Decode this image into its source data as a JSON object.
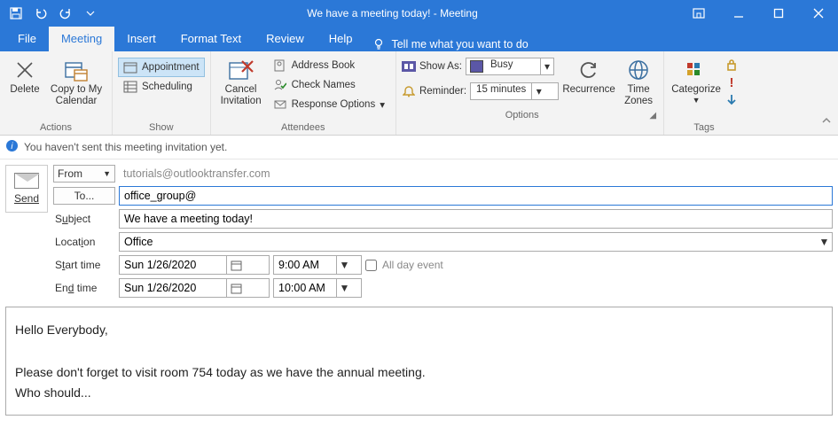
{
  "window": {
    "title": "We have a meeting today!  -  Meeting"
  },
  "tabs": {
    "file": "File",
    "items": [
      "Meeting",
      "Insert",
      "Format Text",
      "Review",
      "Help"
    ],
    "activeIndex": 0,
    "tellme": "Tell me what you want to do"
  },
  "ribbon": {
    "actions": {
      "delete": "Delete",
      "copy": "Copy to My\nCalendar",
      "label": "Actions"
    },
    "show": {
      "appointment": "Appointment",
      "scheduling": "Scheduling",
      "label": "Show"
    },
    "attendees": {
      "cancel": "Cancel\nInvitation",
      "addressBook": "Address Book",
      "checkNames": "Check Names",
      "responseOptions": "Response Options",
      "label": "Attendees"
    },
    "options": {
      "showAs": "Show As:",
      "showAsValue": "Busy",
      "reminder": "Reminder:",
      "reminderValue": "15 minutes",
      "recurrence": "Recurrence",
      "timeZones": "Time\nZones",
      "label": "Options"
    },
    "tags": {
      "categorize": "Categorize",
      "label": "Tags"
    }
  },
  "infobar": {
    "text": "You haven't sent this meeting invitation yet."
  },
  "form": {
    "send": "Send",
    "from": "From",
    "fromValue": "tutorials@outlooktransfer.com",
    "to": "To...",
    "toValue": "office_group@",
    "subject": "Subject",
    "subjectValue": "We have a meeting today!",
    "location": "Location",
    "locationValue": "Office",
    "startTime": "Start time",
    "startDate": "Sun 1/26/2020",
    "startHour": "9:00 AM",
    "endTime": "End time",
    "endDate": "Sun 1/26/2020",
    "endHour": "10:00 AM",
    "allDay": "All day event"
  },
  "body": {
    "line1": "Hello Everybody,",
    "line2": "Please don't forget to visit room 754 today as we have the annual meeting.",
    "line3": "Who should..."
  }
}
